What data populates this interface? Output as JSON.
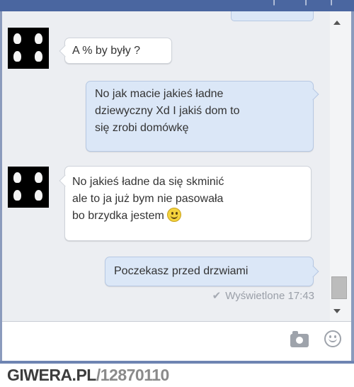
{
  "window": {
    "title": ""
  },
  "messages": [
    {
      "from": "them",
      "lines": [
        "A % by były ?"
      ]
    },
    {
      "from": "me",
      "lines": [
        "No jak macie jakieś ładne",
        "dziewyczny Xd I jakiś dom to",
        "się zrobi domówkę"
      ]
    },
    {
      "from": "them",
      "lines": [
        "No jakieś ładne da się skminić",
        "ale to ja już bym nie pasowała",
        "bo brzydka jestem"
      ],
      "emoji": "smiley"
    },
    {
      "from": "me",
      "lines": [
        "Poczekasz przed drzwiami"
      ]
    }
  ],
  "status": {
    "seen": "Wyświetlone 17:43"
  },
  "composer": {
    "camera_icon": "camera-icon",
    "emoji_icon": "emoji-icon"
  },
  "watermark": {
    "site": "GIWERA.PL",
    "separator": "/",
    "id": "12870110"
  },
  "colors": {
    "outgoing_bubble": "#dbe7f7",
    "incoming_bubble": "#ffffff",
    "chat_bg": "#eceef2",
    "header": "#4a66a0"
  }
}
